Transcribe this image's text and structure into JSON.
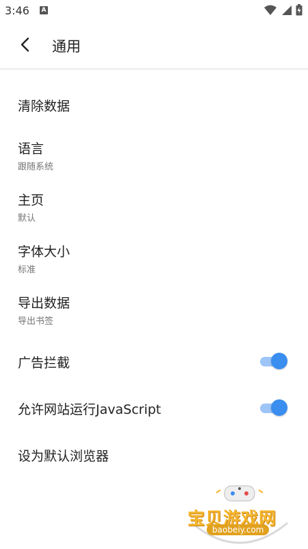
{
  "status_bar": {
    "time": "3:46",
    "notification_letter": "A"
  },
  "toolbar": {
    "title": "通用"
  },
  "settings": {
    "clear_data": {
      "title": "清除数据"
    },
    "language": {
      "title": "语言",
      "subtitle": "跟随系统"
    },
    "homepage": {
      "title": "主页",
      "subtitle": "默认"
    },
    "font_size": {
      "title": "字体大小",
      "subtitle": "标准"
    },
    "export_data": {
      "title": "导出数据",
      "subtitle": "导出书签"
    },
    "ad_block": {
      "title": "广告拦截",
      "enabled": true
    },
    "javascript": {
      "title": "允许网站运行JavaScript",
      "enabled": true
    },
    "default_browser": {
      "title": "设为默认浏览器"
    }
  },
  "watermark": {
    "text": "宝贝游戏网",
    "url": "baobeiy.com"
  },
  "colors": {
    "toggle_thumb": "#3a8ef0",
    "toggle_track": "#9ec5f8",
    "subtitle": "#757575"
  }
}
